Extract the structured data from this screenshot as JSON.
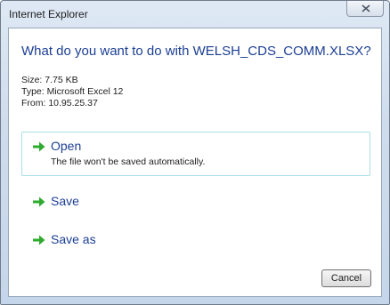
{
  "window": {
    "title": "Internet Explorer"
  },
  "dialog": {
    "heading": "What do you want to do with WELSH_CDS_COMM.XLSX?",
    "size": "Size: 7.75 KB",
    "type": "Type: Microsoft Excel 12",
    "from": "From: 10.95.25.37",
    "options": [
      {
        "label": "Open",
        "description": "The file won't be saved automatically.",
        "selected": true
      },
      {
        "label": "Save"
      },
      {
        "label": "Save as"
      }
    ],
    "cancel_label": "Cancel"
  },
  "colors": {
    "accent": "#1c3f94",
    "arrow": "#2eab2e",
    "selection_border": "#a9dde8"
  },
  "icons": {
    "option_icon": "green-arrow-icon",
    "close_icon": "close-icon"
  }
}
